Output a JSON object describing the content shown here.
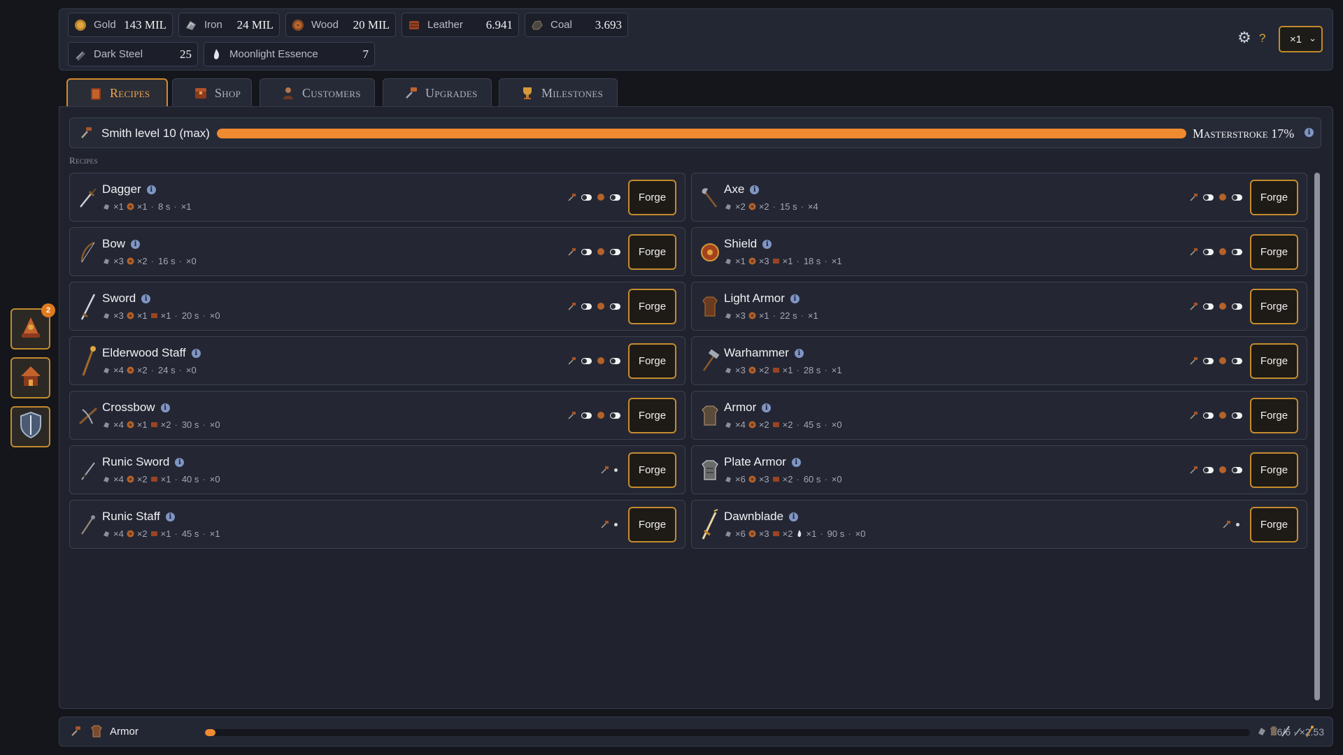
{
  "resources": [
    {
      "name": "Gold",
      "value": "143 MIL",
      "icon": "gold-coin-icon"
    },
    {
      "name": "Iron",
      "value": "24 MIL",
      "icon": "iron-ore-icon"
    },
    {
      "name": "Wood",
      "value": "20 MIL",
      "icon": "wood-icon"
    },
    {
      "name": "Leather",
      "value": "6.941",
      "icon": "leather-icon"
    },
    {
      "name": "Coal",
      "value": "3.693",
      "icon": "coal-icon"
    },
    {
      "name": "Dark Steel",
      "value": "25",
      "icon": "dark-steel-icon"
    },
    {
      "name": "Moonlight Essence",
      "value": "7",
      "icon": "moonlight-essence-icon"
    }
  ],
  "controls": {
    "help": "?",
    "multiplier": "×1"
  },
  "tabs": [
    {
      "label": "Recipes",
      "active": true
    },
    {
      "label": "Shop",
      "active": false
    },
    {
      "label": "Customers",
      "active": false
    },
    {
      "label": "Upgrades",
      "active": false
    },
    {
      "label": "Milestones",
      "active": false
    }
  ],
  "smith": {
    "label": "Smith level 10 (max)",
    "progress_percent": 100,
    "masterstroke": "Masterstroke 17%"
  },
  "section_label": "Recipes",
  "recipes": [
    {
      "name": "Dagger",
      "costs": [
        "×1",
        "×1"
      ],
      "time": "8 s",
      "owned": "×1"
    },
    {
      "name": "Axe",
      "costs": [
        "×2",
        "×2"
      ],
      "time": "15 s",
      "owned": "×4"
    },
    {
      "name": "Bow",
      "costs": [
        "×3",
        "×2"
      ],
      "time": "16 s",
      "owned": "×0"
    },
    {
      "name": "Shield",
      "costs": [
        "×1",
        "×3",
        "×1"
      ],
      "time": "18 s",
      "owned": "×1"
    },
    {
      "name": "Sword",
      "costs": [
        "×3",
        "×1",
        "×1"
      ],
      "time": "20 s",
      "owned": "×0"
    },
    {
      "name": "Light Armor",
      "costs": [
        "×3",
        "×1"
      ],
      "time": "22 s",
      "owned": "×1"
    },
    {
      "name": "Elderwood Staff",
      "costs": [
        "×4",
        "×2"
      ],
      "time": "24 s",
      "owned": "×0"
    },
    {
      "name": "Warhammer",
      "costs": [
        "×3",
        "×2",
        "×1"
      ],
      "time": "28 s",
      "owned": "×1"
    },
    {
      "name": "Crossbow",
      "costs": [
        "×4",
        "×1",
        "×2"
      ],
      "time": "30 s",
      "owned": "×0"
    },
    {
      "name": "Armor",
      "costs": [
        "×4",
        "×2",
        "×2"
      ],
      "time": "45 s",
      "owned": "×0"
    },
    {
      "name": "Runic Sword",
      "costs": [
        "×4",
        "×2",
        "×1"
      ],
      "time": "40 s",
      "owned": "×0"
    },
    {
      "name": "Plate Armor",
      "costs": [
        "×6",
        "×3",
        "×2"
      ],
      "time": "60 s",
      "owned": "×0"
    },
    {
      "name": "Runic Staff",
      "costs": [
        "×4",
        "×2",
        "×1"
      ],
      "time": "45 s",
      "owned": "×1"
    },
    {
      "name": "Dawnblade",
      "costs": [
        "×6",
        "×3",
        "×2",
        "×1"
      ],
      "time": "90 s",
      "owned": "×0"
    }
  ],
  "forge_label": "Forge",
  "side_badge": "2",
  "queue": {
    "item": "Armor",
    "progress_percent": 1,
    "stat": "6/6 · ×2.53"
  },
  "colors": {
    "accent": "#f08a30",
    "gold_border": "#c18a2c",
    "panel": "#20232d"
  }
}
